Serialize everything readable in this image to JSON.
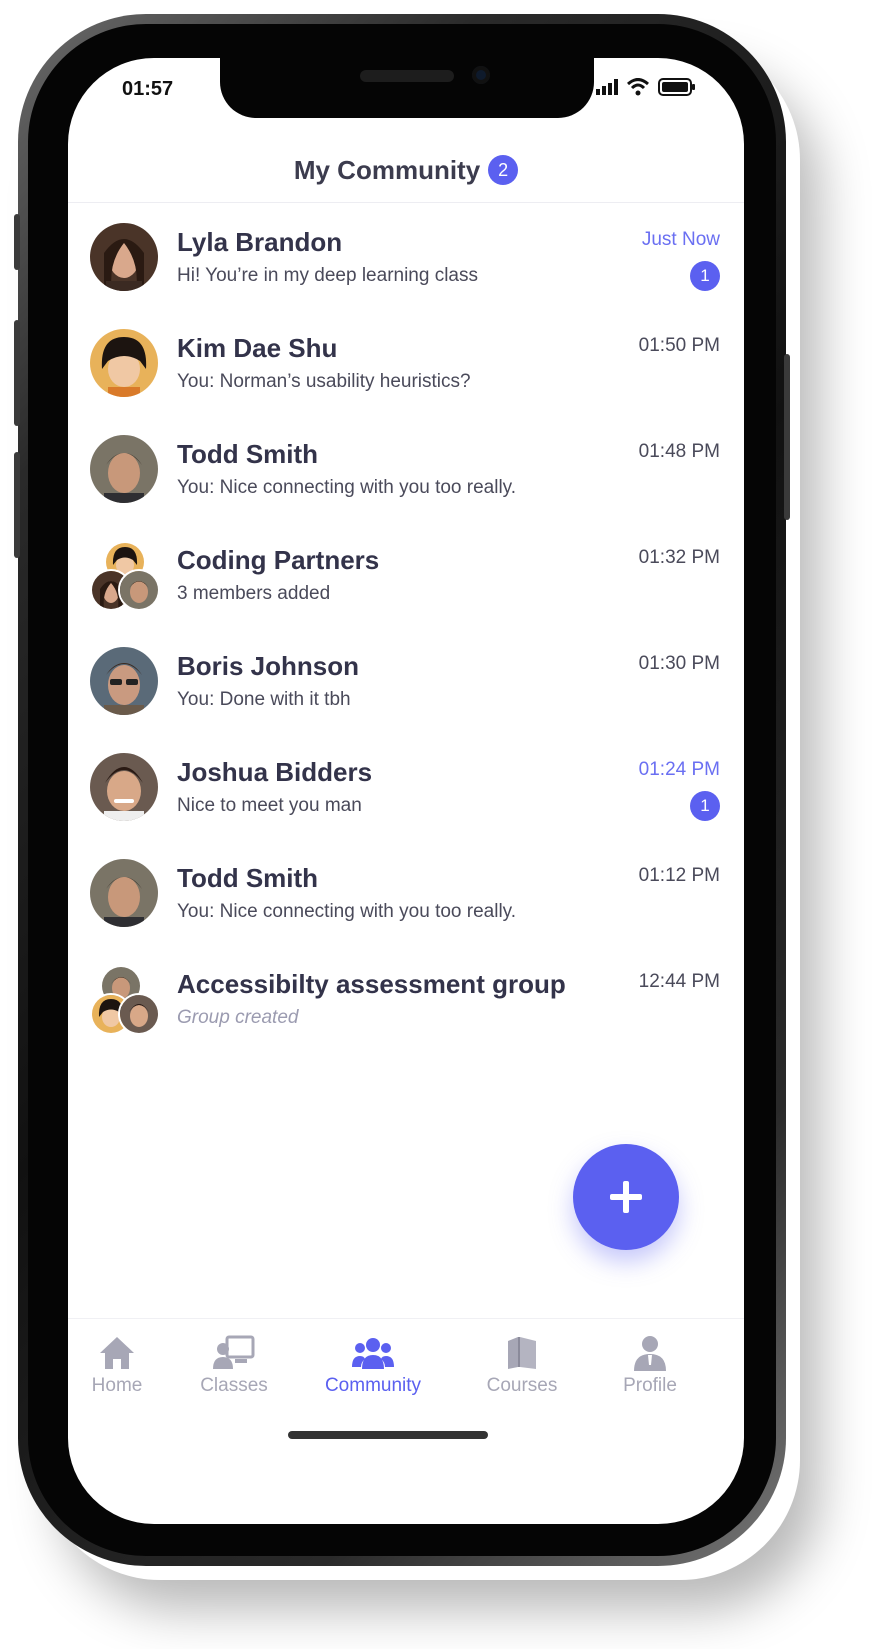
{
  "status_bar": {
    "time": "01:57"
  },
  "header": {
    "title": "My Community",
    "badge": "2"
  },
  "conversations": [
    {
      "name": "Lyla Brandon",
      "preview": "Hi! You’re in my deep learning class",
      "time": "Just Now",
      "unread": "1",
      "highlight": true
    },
    {
      "name": "Kim Dae Shu",
      "preview": "You: Norman’s usability heuristics?",
      "time": "01:50 PM"
    },
    {
      "name": "Todd Smith",
      "preview": "You: Nice connecting with you too really.",
      "time": "01:48 PM"
    },
    {
      "name": "Coding Partners",
      "preview": "3 members added",
      "time": "01:32 PM",
      "group": true
    },
    {
      "name": "Boris Johnson",
      "preview": "You: Done with it tbh",
      "time": "01:30 PM"
    },
    {
      "name": "Joshua Bidders",
      "preview": "Nice to meet you man",
      "time": "01:24 PM",
      "unread": "1",
      "highlight": true
    },
    {
      "name": "Todd Smith",
      "preview": "You: Nice connecting with you too really.",
      "time": "01:12 PM"
    },
    {
      "name": "Accessibilty assessment group",
      "preview": "Group created",
      "time": "12:44 PM",
      "group": true
    }
  ],
  "fab": {
    "icon": "plus-icon",
    "label": "+"
  },
  "tabs": [
    {
      "label": "Home",
      "icon": "home-icon"
    },
    {
      "label": "Classes",
      "icon": "classes-icon"
    },
    {
      "label": "Community",
      "icon": "community-icon",
      "active": true
    },
    {
      "label": "Courses",
      "icon": "courses-icon"
    },
    {
      "label": "Profile",
      "icon": "profile-icon"
    }
  ],
  "colors": {
    "accent": "#5b60f0",
    "text_primary": "#33334a",
    "text_secondary": "#4a4a5a",
    "tab_inactive": "#a7a7b6"
  }
}
